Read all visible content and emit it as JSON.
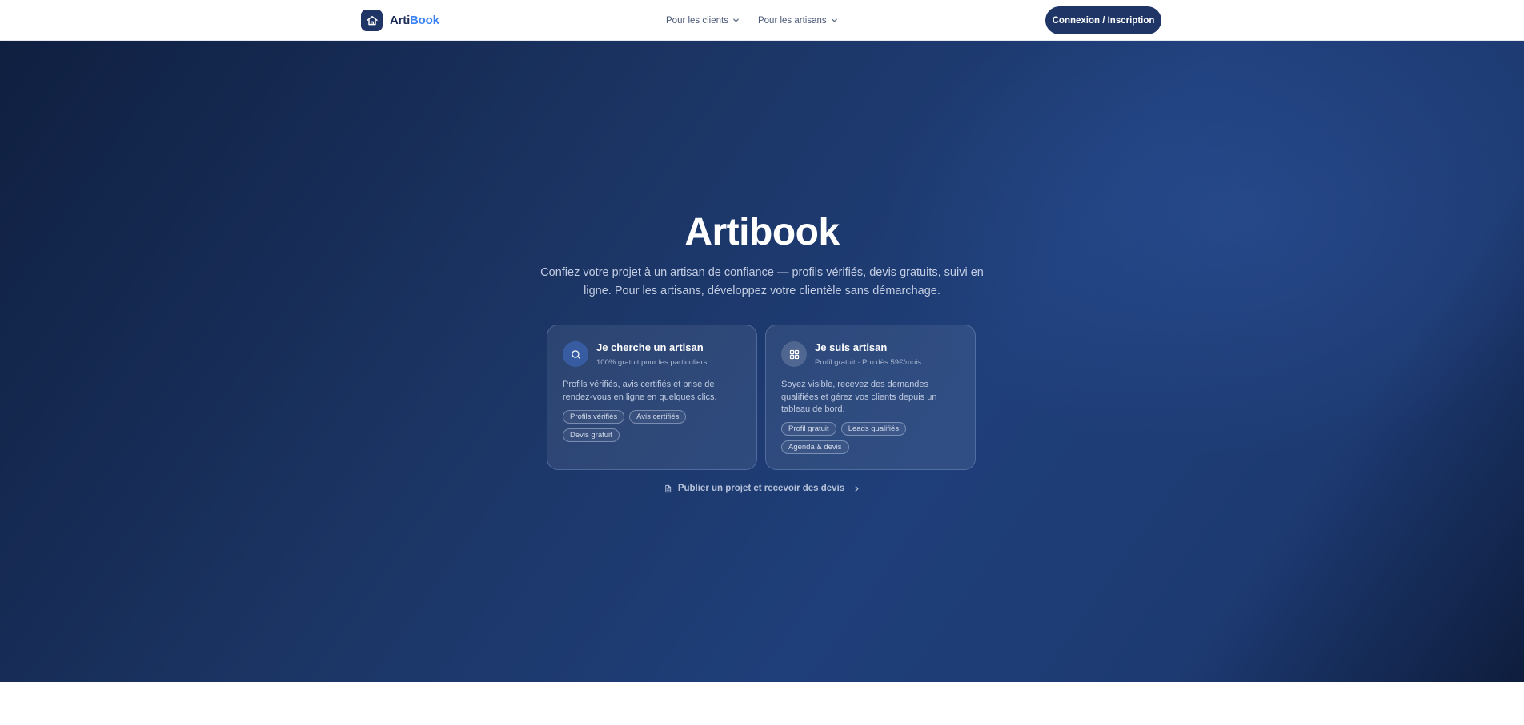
{
  "header": {
    "logo": {
      "part1": "Arti",
      "part2": "Book",
      "icon": "house-icon"
    },
    "nav": [
      {
        "label": "Pour les clients",
        "icon": "chevron-down-icon"
      },
      {
        "label": "Pour les artisans",
        "icon": "chevron-down-icon"
      }
    ],
    "login_label": "Connexion / Inscription"
  },
  "hero": {
    "title": "Artibook",
    "subtitle": "Confiez votre projet à un artisan de confiance — profils vérifiés, devis gratuits, suivi en ligne. Pour les artisans, développez votre clientèle sans démarchage.",
    "cards": [
      {
        "icon": "search-icon",
        "title": "Je cherche un artisan",
        "subtitle": "100% gratuit pour les particuliers",
        "description": "Profils vérifiés, avis certifiés et prise de rendez-vous en ligne en quelques clics.",
        "tags": [
          "Profils vérifiés",
          "Avis certifiés",
          "Devis gratuit"
        ]
      },
      {
        "icon": "dashboard-grid-icon",
        "title": "Je suis artisan",
        "subtitle": "Profil gratuit · Pro dès 59€/mois",
        "description": "Soyez visible, recevez des demandes qualifiées et gérez vos clients depuis un tableau de bord.",
        "tags": [
          "Profil gratuit",
          "Leads qualifiés",
          "Agenda & devis"
        ]
      }
    ],
    "publish_link": {
      "label": "Publier un projet et recevoir des devis",
      "icon": "document-icon",
      "arrow_icon": "chevron-right-icon"
    }
  },
  "colors": {
    "brand_navy": "#1e3566",
    "brand_blue": "#3b82f6",
    "hero_dark": "#0f1f40",
    "hero_mid": "#1f3f7a"
  }
}
